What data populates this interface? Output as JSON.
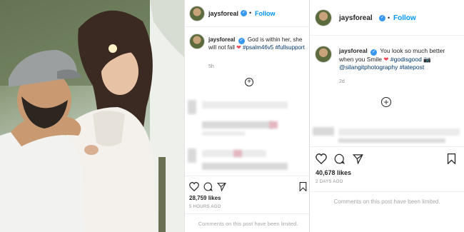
{
  "post_left": {
    "username": "jaysforeal",
    "follow_label": "Follow",
    "dot": "•",
    "caption_text": "God is within her, she will not fall",
    "caption_tags": "#psalm46v5 #fullsupport",
    "caption_time": "5h",
    "likes": "28,759 likes",
    "time_ago": "5 HOURS AGO",
    "comments_notice": "Comments on this post have been limited."
  },
  "post_right": {
    "username": "jaysforeal",
    "follow_label": "Follow",
    "dot": "•",
    "caption_text": "You look so much better when you Smile",
    "caption_tags_a": "#godisgood",
    "caption_tags_b": "@silangitphotography #latepost",
    "caption_time": "2d",
    "likes": "40,678 likes",
    "time_ago": "2 DAYS AGO",
    "comments_notice": "Comments on this post have been limited."
  },
  "icons": {
    "verified": "✓",
    "plus": "+",
    "heart_emoji": "❤",
    "camera_emoji": "📷"
  },
  "colors": {
    "link": "#0095f6",
    "verified": "#3897f0",
    "heart": "#ed4956"
  }
}
